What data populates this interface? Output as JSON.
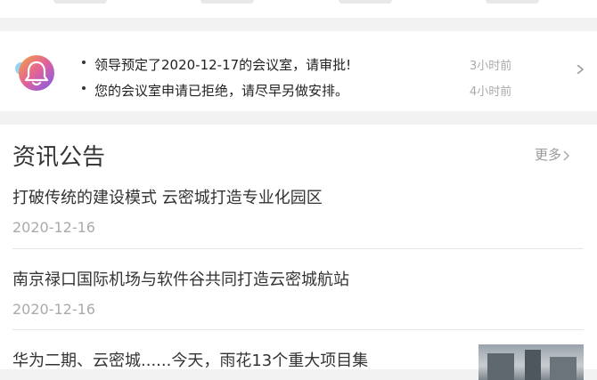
{
  "notifications": {
    "items": [
      {
        "text": "领导预定了2020-12-17的会议室，请审批!",
        "time": "3小时前"
      },
      {
        "text": "您的会议室申请已拒绝，请尽早另做安排。",
        "time": "4小时前"
      }
    ],
    "icon": "bell-icon"
  },
  "news": {
    "title": "资讯公告",
    "more_label": "更多",
    "items": [
      {
        "title": "打破传统的建设模式 云密城打造专业化园区",
        "date": "2020-12-16"
      },
      {
        "title": "南京禄口国际机场与软件谷共同打造云密城航站",
        "date": "2020-12-16"
      },
      {
        "title": "华为二期、云密城......今天，雨花13个重大项目集",
        "date": ""
      }
    ]
  },
  "colors": {
    "bell_gradient_start": "#f0a24a",
    "bell_gradient_end": "#7b5cf0",
    "accent_text": "#333333"
  }
}
